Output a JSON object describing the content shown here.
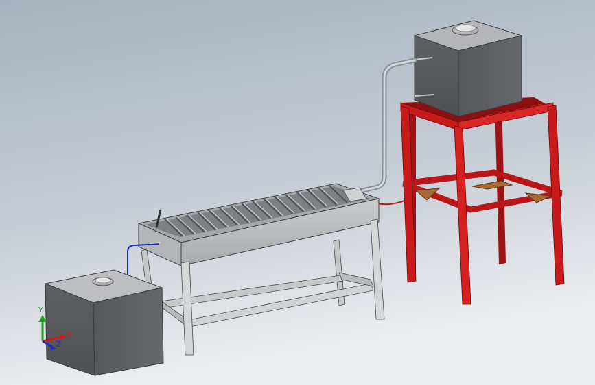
{
  "triad": {
    "x_label": "X",
    "y_label": "Y",
    "z_label": "Z"
  },
  "colors": {
    "background_top": "#a9b4c1",
    "background_bottom": "#e6e8ec",
    "tank_dark": "#585a5c",
    "tank_light": "#babcbf",
    "frame_gray": "#b6b8ba",
    "frame_red": "#c8191b",
    "plate_brown": "#a76a35",
    "pipe_silver": "#9ea4aa",
    "pipe_blue": "#1a2ea5",
    "pipe_red": "#b4161a",
    "axis_x": "#d81818",
    "axis_y": "#1ea51e",
    "axis_z": "#1c2ec9"
  }
}
